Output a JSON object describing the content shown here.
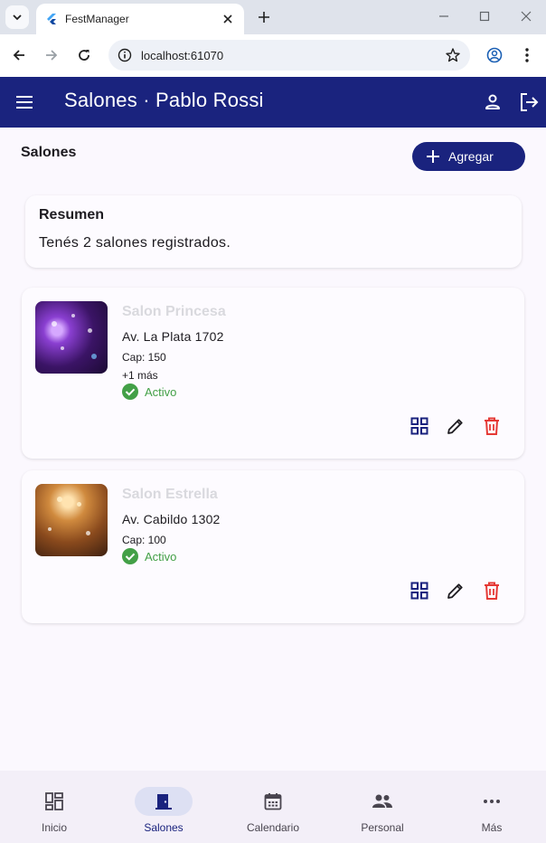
{
  "browser": {
    "tab_title": "FestManager",
    "url": "localhost:61070"
  },
  "appbar": {
    "title": "Salones · Pablo Rossi"
  },
  "page": {
    "heading": "Salones",
    "add_label": "Agregar"
  },
  "summary": {
    "title": "Resumen",
    "text": "Tenés 2 salones registrados."
  },
  "salones": [
    {
      "name": "Salon Princesa",
      "address": "Av. La Plata 1702",
      "capacity": "Cap: 150",
      "more": "+1 más",
      "status": "Activo"
    },
    {
      "name": "Salon Estrella",
      "address": "Av. Cabildo 1302",
      "capacity": "Cap: 100",
      "status": "Activo"
    }
  ],
  "bottom_nav": [
    {
      "label": "Inicio",
      "icon": "dashboard-icon",
      "active": false
    },
    {
      "label": "Salones",
      "icon": "door-icon",
      "active": true
    },
    {
      "label": "Calendario",
      "icon": "calendar-icon",
      "active": false
    },
    {
      "label": "Personal",
      "icon": "people-icon",
      "active": false
    },
    {
      "label": "Más",
      "icon": "more-horiz-icon",
      "active": false
    }
  ],
  "colors": {
    "primary": "#1a237e",
    "active_status": "#43a047",
    "delete": "#e53935"
  }
}
